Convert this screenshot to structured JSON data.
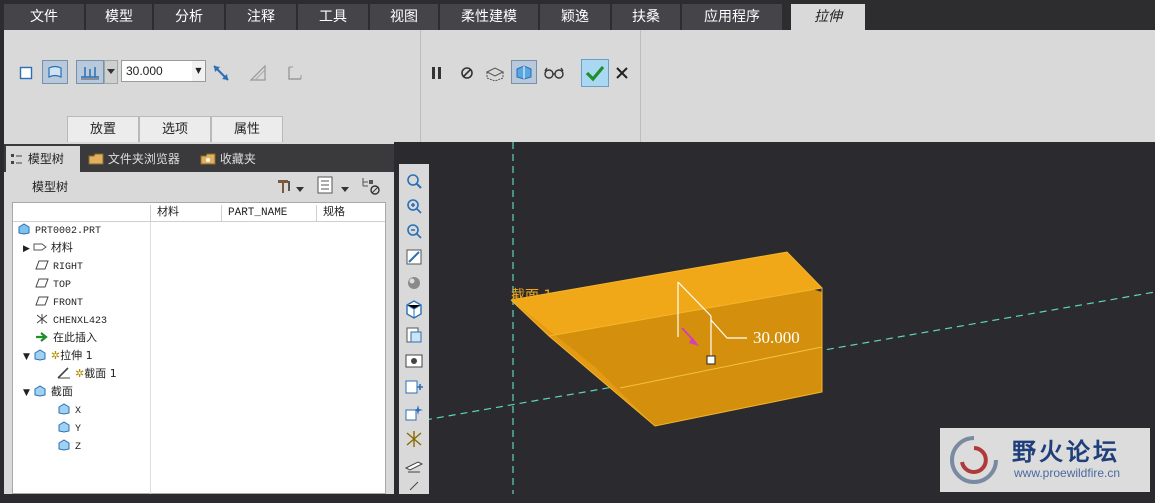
{
  "menu": {
    "tabs": [
      "文件",
      "模型",
      "分析",
      "注释",
      "工具",
      "视图",
      "柔性建模",
      "颖逸",
      "扶桑",
      "应用程序"
    ],
    "active_tab": "拉伸"
  },
  "ribbon": {
    "depth_value": "30.000",
    "bottom_tabs": [
      "放置",
      "选项",
      "属性"
    ]
  },
  "panel": {
    "tabs": [
      "模型树",
      "文件夹浏览器",
      "收藏夹"
    ],
    "tree_title": "模型树",
    "columns": [
      "材料",
      "PART_NAME",
      "规格"
    ],
    "items": [
      {
        "label": "PRT0002.PRT",
        "indent": 0,
        "expander": ""
      },
      {
        "label": "材料",
        "indent": 1,
        "expander": "▶"
      },
      {
        "label": "RIGHT",
        "indent": 1,
        "expander": ""
      },
      {
        "label": "TOP",
        "indent": 1,
        "expander": ""
      },
      {
        "label": "FRONT",
        "indent": 1,
        "expander": ""
      },
      {
        "label": "CHENXL423",
        "indent": 1,
        "expander": ""
      },
      {
        "label": "在此插入",
        "indent": 1,
        "expander": ""
      },
      {
        "label": "拉伸 1",
        "indent": 1,
        "expander": "▼"
      },
      {
        "label": "截面 1",
        "indent": 2,
        "expander": ""
      },
      {
        "label": "截面",
        "indent": 1,
        "expander": "▼"
      },
      {
        "label": "X",
        "indent": 2,
        "expander": ""
      },
      {
        "label": "Y",
        "indent": 2,
        "expander": ""
      },
      {
        "label": "Z",
        "indent": 2,
        "expander": ""
      }
    ]
  },
  "viewport": {
    "section_label": "截面 1",
    "dimension_value": "30.000",
    "solid_color": "#e8a020"
  },
  "watermark": {
    "title": "野火论坛",
    "url": "www.proewildfire.cn"
  }
}
